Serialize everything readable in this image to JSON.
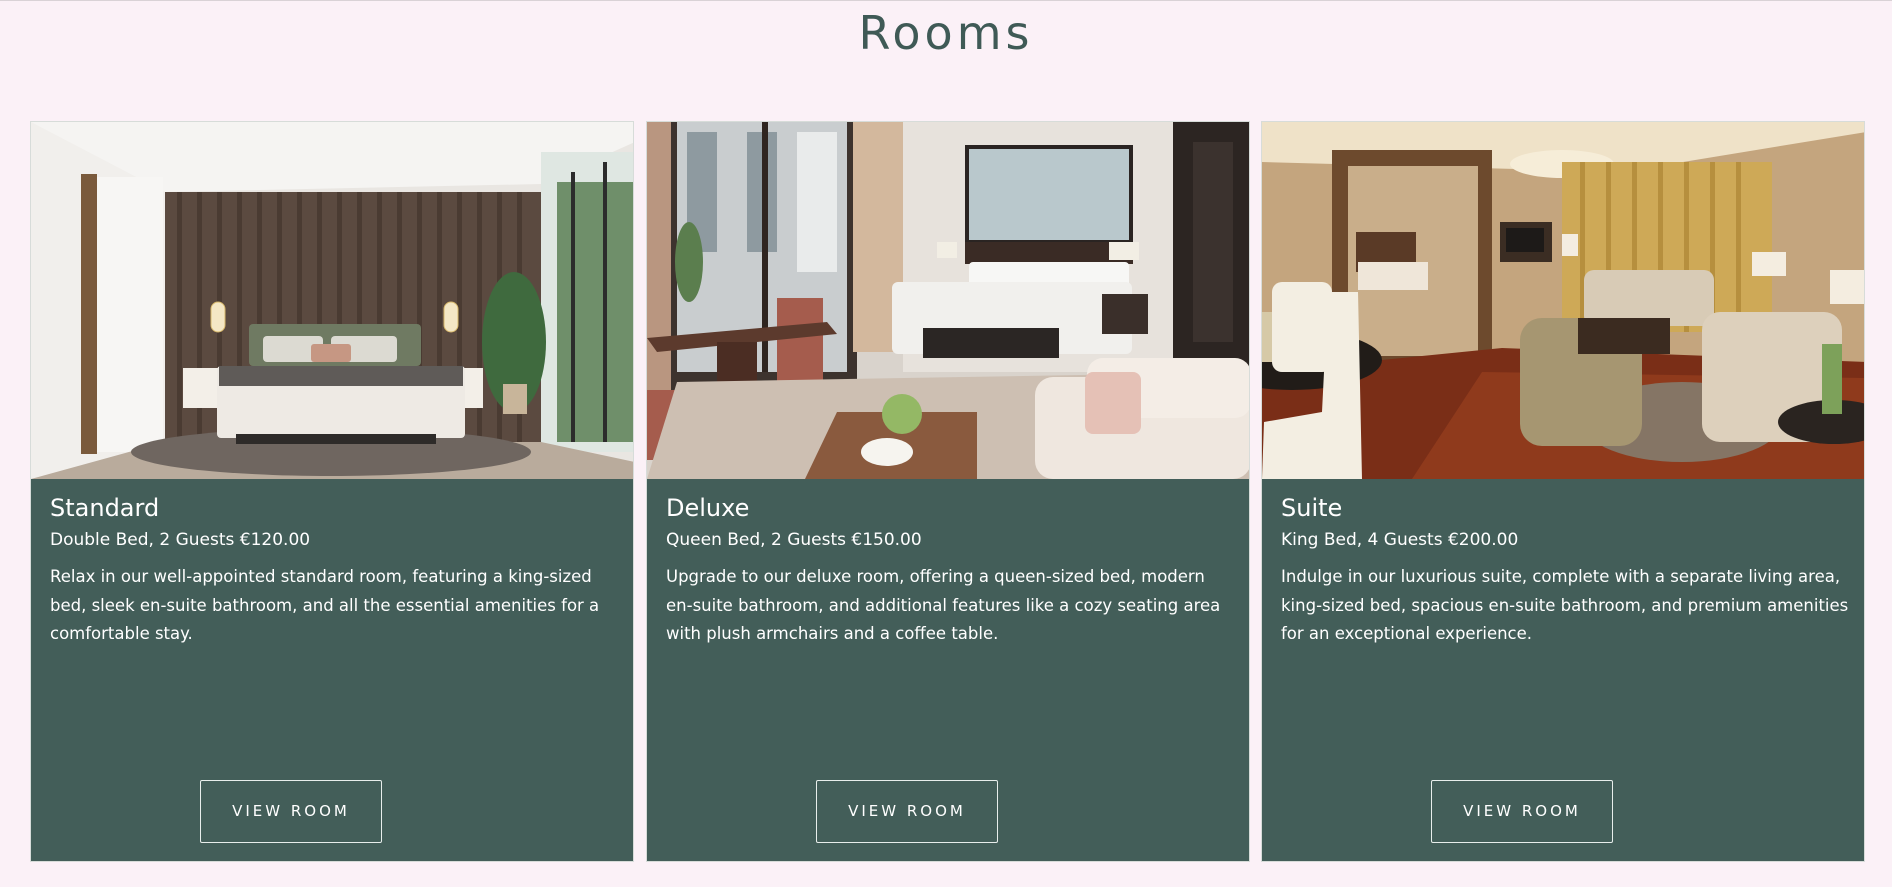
{
  "page": {
    "title": "Rooms"
  },
  "rooms": [
    {
      "name": "Standard",
      "meta": "Double Bed, 2 Guests €120.00",
      "description": "Relax in our well-appointed standard room, featuring a king-sized bed, sleek en-suite bathroom, and all the essential amenities for a comfortable stay.",
      "button_label": "VIEW ROOM",
      "photo_icon": "bedroom-photo"
    },
    {
      "name": "Deluxe",
      "meta": "Queen Bed, 2 Guests €150.00",
      "description": "Upgrade to our deluxe room, offering a queen-sized bed, modern en-suite bathroom, and additional features like a cozy seating area with plush armchairs and a coffee table.",
      "button_label": "VIEW ROOM",
      "photo_icon": "deluxe-room-photo"
    },
    {
      "name": "Suite",
      "meta": "King Bed, 4 Guests €200.00",
      "description": "Indulge in our luxurious suite, complete with a separate living area, king-sized bed, spacious en-suite bathroom, and premium amenities for an exceptional experience.",
      "button_label": "VIEW ROOM",
      "photo_icon": "suite-photo"
    }
  ],
  "colors": {
    "page_background": "#fbf1f7",
    "card_background": "#435e59",
    "title_color": "#3f5a56",
    "text_color": "#ffffff"
  }
}
